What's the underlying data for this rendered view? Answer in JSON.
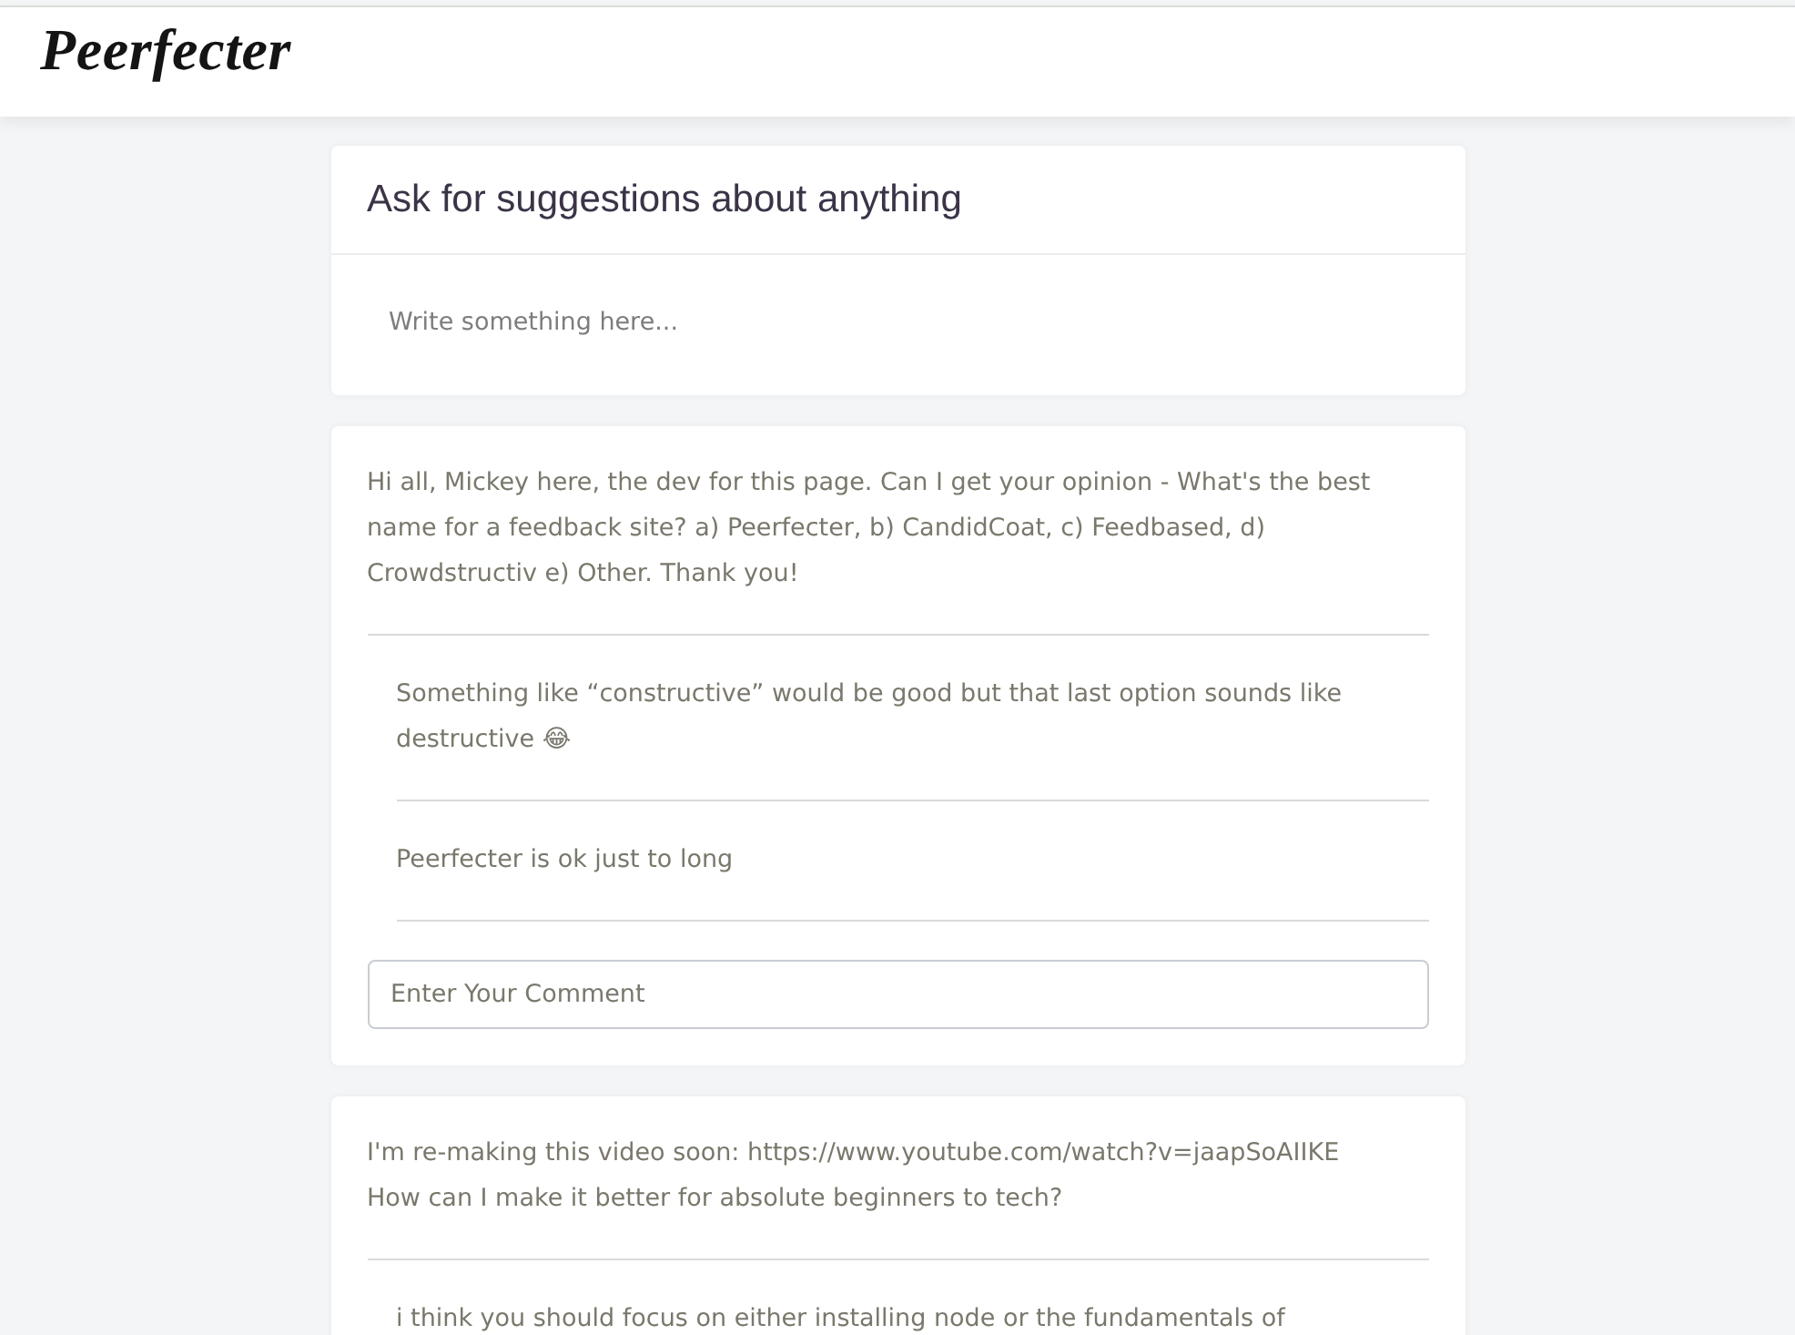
{
  "header": {
    "logo": "Peerfecter"
  },
  "composer": {
    "title": "Ask for suggestions about anything",
    "placeholder": "Write something here..."
  },
  "posts": [
    {
      "text": "Hi all, Mickey here, the dev for this page. Can I get your opinion - What's the best name for a feedback site? a) Peerfecter, b) CandidCoat, c) Feedbased, d) Crowdstructiv e) Other. Thank you!",
      "comments": [
        {
          "text": "Something like “constructive” would be good but that last option sounds like destructive 😂"
        },
        {
          "text": "Peerfecter is ok just to long"
        }
      ],
      "comment_field": {
        "placeholder": "Enter Your Comment"
      }
    },
    {
      "text": "I'm re-making this video soon: https://www.youtube.com/watch?v=jaapSoAIIKE\nHow can I make it better for absolute beginners to tech?",
      "comments": [
        {
          "text": "i think you should focus on either installing node or the fundamentals of"
        }
      ]
    }
  ]
}
